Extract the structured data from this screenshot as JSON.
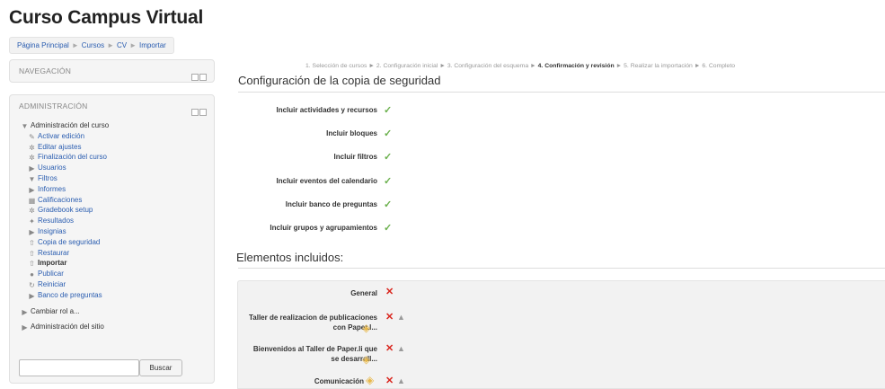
{
  "site_title": "Curso Campus Virtual",
  "breadcrumb": [
    "Página Principal",
    "Cursos",
    "CV",
    "Importar"
  ],
  "breadcrumb_sep": "►",
  "nav_block": {
    "title": "NAVEGACIÓN"
  },
  "admin_block": {
    "title": "ADMINISTRACIÓN",
    "course_admin": "Administración del curso",
    "items": [
      {
        "label": "Activar edición",
        "icon": "pencil-icon"
      },
      {
        "label": "Editar ajustes",
        "icon": "gear-icon"
      },
      {
        "label": "Finalización del curso",
        "icon": "gear-icon"
      },
      {
        "label": "Usuarios",
        "icon": "chevron-right-icon"
      },
      {
        "label": "Filtros",
        "icon": "filter-icon"
      },
      {
        "label": "Informes",
        "icon": "chevron-right-icon"
      },
      {
        "label": "Calificaciones",
        "icon": "grades-icon"
      },
      {
        "label": "Gradebook setup",
        "icon": "gear-icon"
      },
      {
        "label": "Resultados",
        "icon": "outcomes-icon"
      },
      {
        "label": "Insignias",
        "icon": "chevron-right-icon"
      },
      {
        "label": "Copia de seguridad",
        "icon": "backup-icon"
      },
      {
        "label": "Restaurar",
        "icon": "restore-icon"
      },
      {
        "label": "Importar",
        "icon": "import-icon"
      },
      {
        "label": "Publicar",
        "icon": "publish-icon"
      },
      {
        "label": "Reiniciar",
        "icon": "reset-icon"
      },
      {
        "label": "Banco de preguntas",
        "icon": "chevron-right-icon"
      }
    ],
    "switch_role": "Cambiar rol a...",
    "site_admin": "Administración del sitio",
    "search_button": "Buscar",
    "search_value": ""
  },
  "steps": {
    "s1": "1. Selección de cursos",
    "s2": "2. Configuración inicial",
    "s3": "3. Configuración del esquema",
    "s4": "4. Confirmación y revisión",
    "s5": "5. Realizar la importación",
    "s6": "6. Completo",
    "arrow": "►"
  },
  "backup_settings_title": "Configuración de la copia de seguridad",
  "backup_settings": [
    "Incluir actividades y recursos",
    "Incluir bloques",
    "Incluir filtros",
    "Incluir eventos del calendario",
    "Incluir banco de preguntas",
    "Incluir grupos y agrupamientos"
  ],
  "included_title": "Elementos incluidos:",
  "included_items": [
    {
      "line1": "General",
      "line2": ""
    },
    {
      "line1": "Taller de realizacion de publicaciones",
      "line2": "con Paper.l..."
    },
    {
      "line1": "Bienvenidos al Taller de Paper.li que",
      "line2": "se desarroll..."
    },
    {
      "line1": "Comunicación",
      "line2": ""
    }
  ],
  "colors": {
    "link": "#2a5db0",
    "check": "#6ab04c",
    "cross": "#d9251d"
  }
}
